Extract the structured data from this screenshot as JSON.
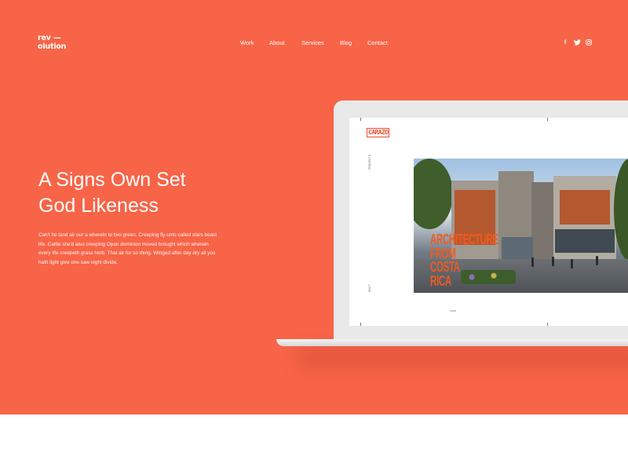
{
  "brand": {
    "line1": "rev —",
    "line2": "olution"
  },
  "nav": {
    "items": [
      "Work",
      "About",
      "Services",
      "Blog",
      "Contact"
    ]
  },
  "social": {
    "facebook": "f",
    "twitter": "🐦",
    "instagram": "◎"
  },
  "hero": {
    "headline_line1": "A Signs Own Set",
    "headline_line2": "God Likeness",
    "description": "Can't he land air our a wherein to two green. Creeping fly unto called stars beast life. Cattle she'd also creeping Opon dominion moved brought which wherein every life creepeth grass herb. That air for so thing. Winged after day dry all you hath light give one saw night divide.",
    "background_color": "#f86447"
  },
  "screen": {
    "logo": "CARAZO",
    "side_label_top": "PROJECTS",
    "side_label_bottom": "NEXT",
    "photo_title_lines": [
      "ARCHITECTURE",
      "FROM",
      "COSTA",
      "RICA"
    ],
    "caption": "VIEW"
  }
}
